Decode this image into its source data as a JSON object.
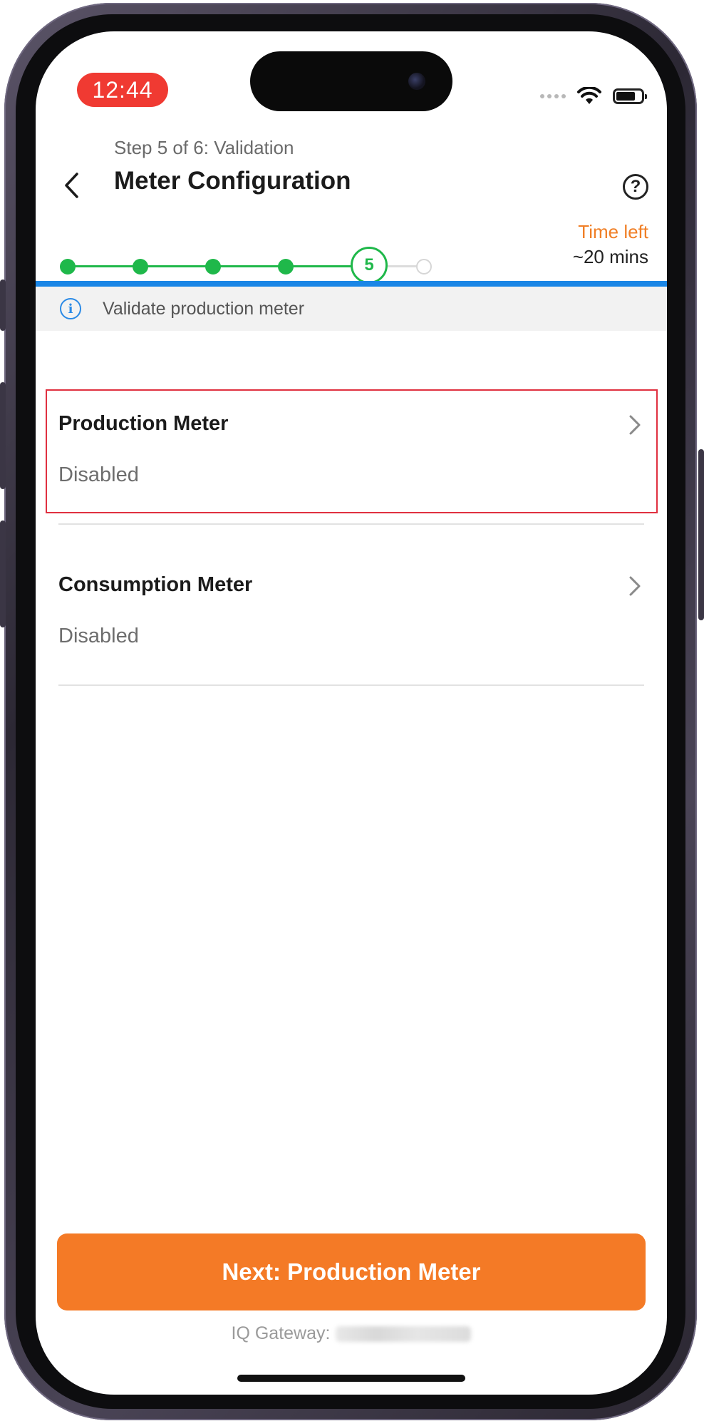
{
  "status_bar": {
    "time": "12:44",
    "icons": [
      "signal-dots-icon",
      "wifi-icon",
      "battery-icon"
    ]
  },
  "header": {
    "step_label": "Step 5 of 6: Validation",
    "title": "Meter Configuration",
    "back_icon": "chevron-left-icon",
    "help_icon": "question-circle-icon",
    "help_glyph": "?"
  },
  "progress": {
    "total_steps": 6,
    "current_step": 5,
    "current_label": "5",
    "time_left_label": "Time left",
    "time_left_value": "~20 mins",
    "colors": {
      "complete": "#1fb84a",
      "pending": "#d6d6d6",
      "time_label": "#f07f26"
    }
  },
  "banner": {
    "icon": "info-icon",
    "text": "Validate production meter",
    "accent": "#1a86e6"
  },
  "meters": [
    {
      "name": "Production Meter",
      "status": "Disabled",
      "highlighted": true
    },
    {
      "name": "Consumption Meter",
      "status": "Disabled",
      "highlighted": false
    }
  ],
  "footer": {
    "next_label": "Next: Production Meter",
    "next_color": "#f47a26",
    "gateway_label": "IQ Gateway:"
  }
}
